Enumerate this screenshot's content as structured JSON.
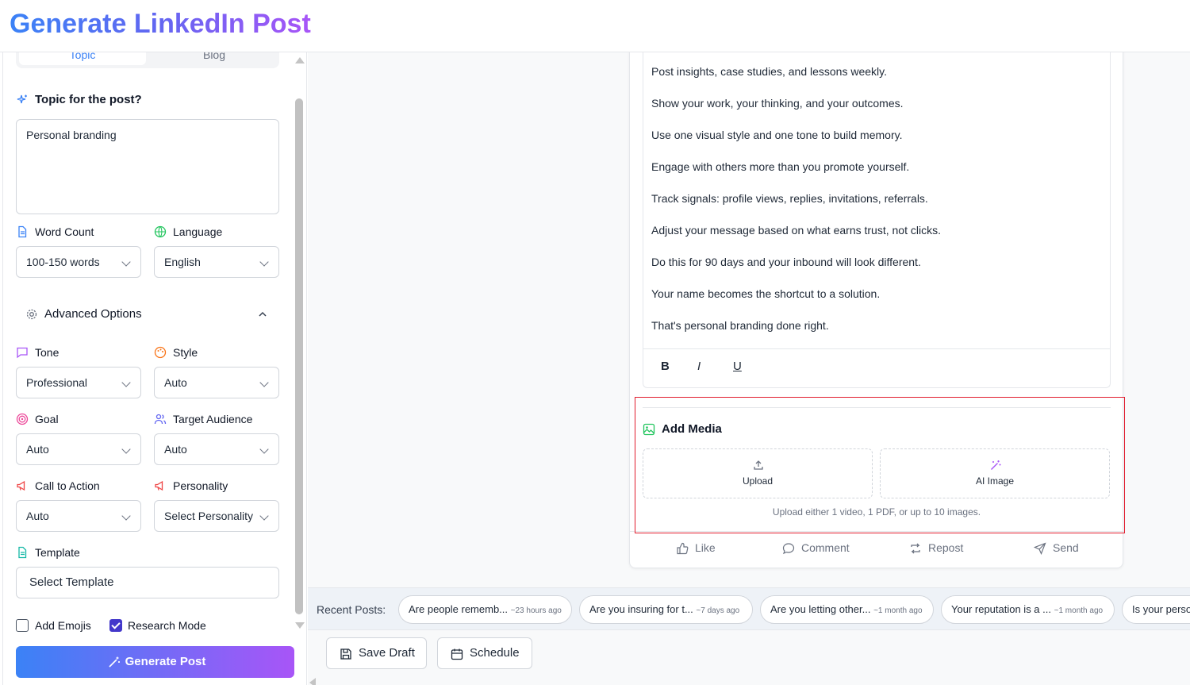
{
  "header": {
    "title": "Generate LinkedIn Post"
  },
  "sidebar": {
    "tabs": [
      "Topic",
      "Blog"
    ],
    "topic_label": "Topic for the post?",
    "topic_value": "Personal branding",
    "word_count": {
      "label": "Word Count",
      "value": "100-150 words"
    },
    "language": {
      "label": "Language",
      "value": "English"
    },
    "advanced_label": "Advanced Options",
    "tone": {
      "label": "Tone",
      "value": "Professional"
    },
    "style": {
      "label": "Style",
      "value": "Auto"
    },
    "goal": {
      "label": "Goal",
      "value": "Auto"
    },
    "audience": {
      "label": "Target Audience",
      "value": "Auto"
    },
    "cta": {
      "label": "Call to Action",
      "value": "Auto"
    },
    "personality": {
      "label": "Personality",
      "value": "Select Personality"
    },
    "template": {
      "label": "Template",
      "value": "Select Template"
    },
    "add_emojis": {
      "label": "Add Emojis",
      "checked": false
    },
    "research_mode": {
      "label": "Research Mode",
      "checked": true
    },
    "generate_label": "Generate Post"
  },
  "post": {
    "lines": [
      "Post insights, case studies, and lessons weekly.",
      "Show your work, your thinking, and your outcomes.",
      "Use one visual style and one tone to build memory.",
      "Engage with others more than you promote yourself.",
      "Track signals: profile views, replies, invitations, referrals.",
      "Adjust your message based on what earns trust, not clicks.",
      "Do this for 90 days and your inbound will look different.",
      "Your name becomes the shortcut to a solution.",
      "That's personal branding done right."
    ],
    "toolbar": {
      "bold": "B",
      "italic": "I",
      "underline": "U"
    },
    "media": {
      "title": "Add Media",
      "upload": "Upload",
      "ai_image": "AI Image",
      "hint": "Upload either 1 video, 1 PDF, or up to 10 images."
    },
    "actions": {
      "like": "Like",
      "comment": "Comment",
      "repost": "Repost",
      "send": "Send"
    }
  },
  "recent": {
    "label": "Recent Posts:",
    "items": [
      {
        "text": "Are people rememb...",
        "time": "~23 hours ago"
      },
      {
        "text": "Are you insuring for t...",
        "time": "~7 days ago"
      },
      {
        "text": "Are you letting other...",
        "time": "~1 month ago"
      },
      {
        "text": "Your reputation is a ...",
        "time": "~1 month ago"
      },
      {
        "text": "Is your perso",
        "time": ""
      }
    ]
  },
  "footer": {
    "save_draft": "Save Draft",
    "schedule": "Schedule"
  },
  "colors": {
    "accent_blue": "#3b82f6",
    "accent_purple": "#a855f7",
    "highlight_red": "#e11d2e"
  }
}
